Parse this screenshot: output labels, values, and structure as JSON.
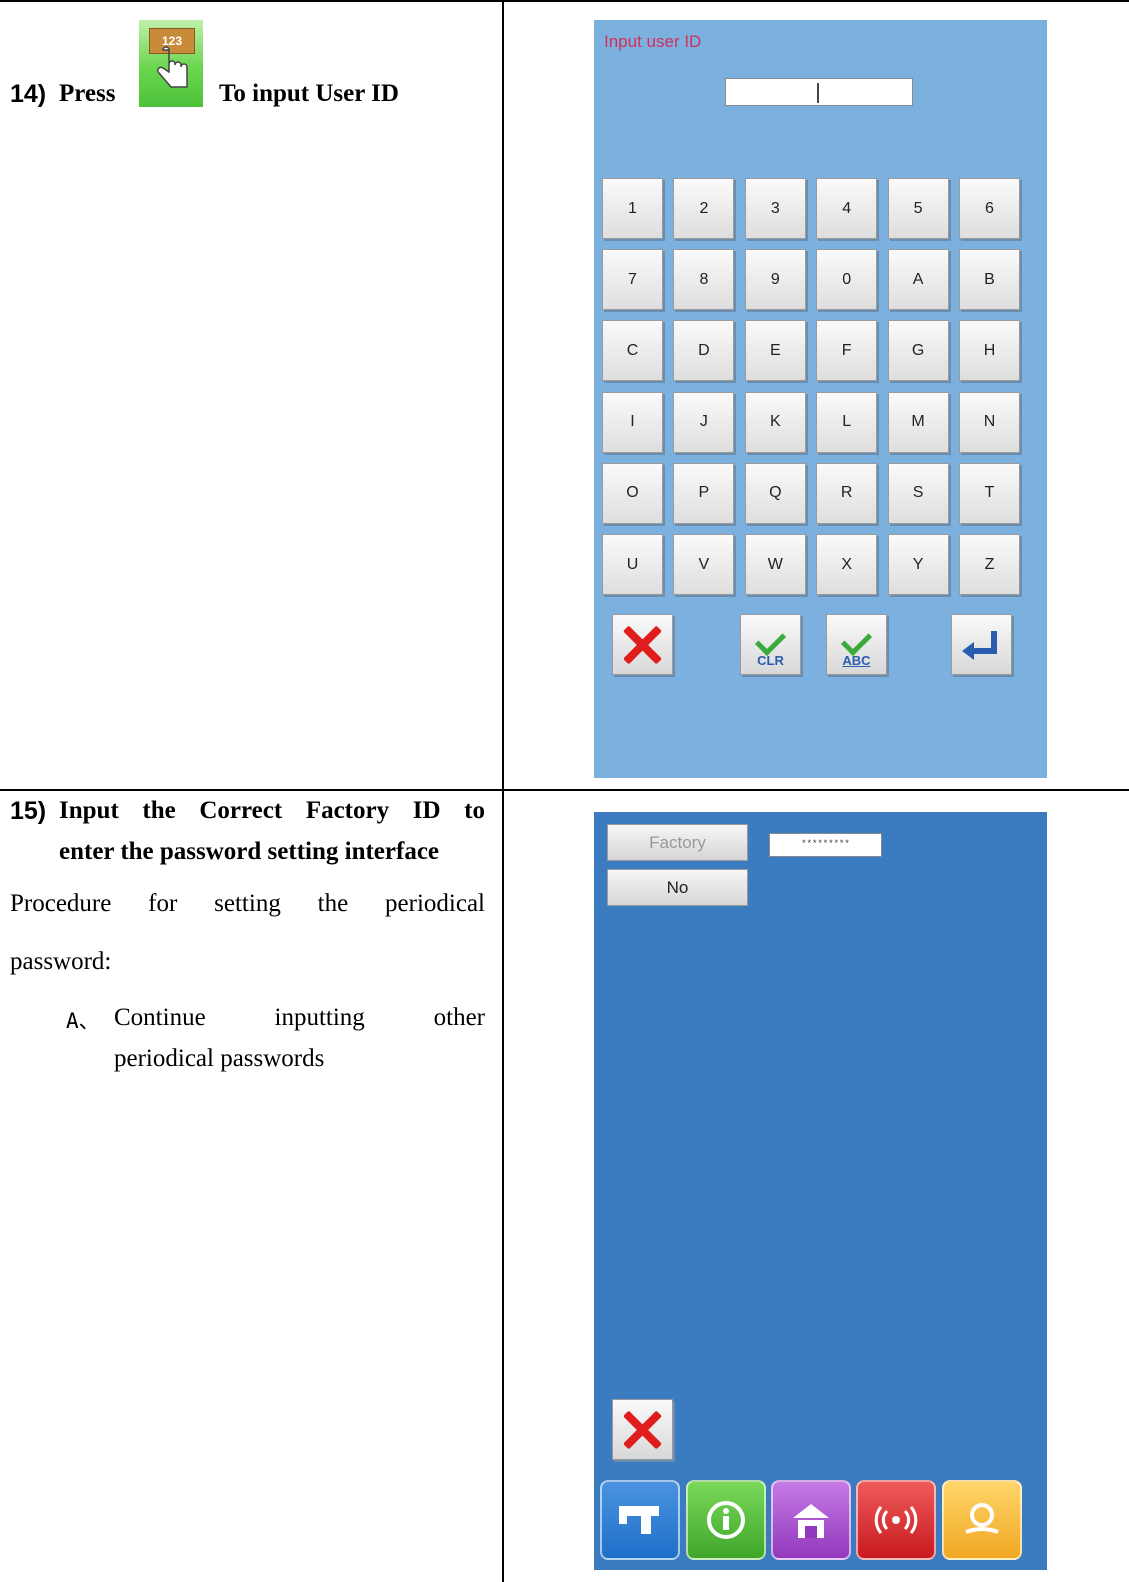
{
  "step14": {
    "number": "14)",
    "press": "Press",
    "rest": "To input User ID",
    "icon": "green-press-icon",
    "icon_digits": "123"
  },
  "screen1": {
    "title": "Input user ID",
    "keys": [
      "1",
      "2",
      "3",
      "4",
      "5",
      "6",
      "7",
      "8",
      "9",
      "0",
      "A",
      "B",
      "C",
      "D",
      "E",
      "F",
      "G",
      "H",
      "I",
      "J",
      "K",
      "L",
      "M",
      "N",
      "O",
      "P",
      "Q",
      "R",
      "S",
      "T",
      "U",
      "V",
      "W",
      "X",
      "Y",
      "Z"
    ],
    "clr_label": "CLR",
    "abc_label": "ABC",
    "bg_color": "#7cb0df",
    "title_color": "#d2305a"
  },
  "step15": {
    "number": "15)",
    "heading_line1": "Input the Correct Factory ID to",
    "heading_line2": "enter the password setting interface",
    "para_line1": "Procedure for setting the periodical",
    "para_line2": "password:",
    "item_marker": "A、",
    "item_line1": "Continue inputting other",
    "item_line2": "periodical passwords"
  },
  "screen2": {
    "factory_label": "Factory",
    "password_mask": "*********",
    "no_label": "No",
    "bg_color": "#3b7cc0",
    "tabs": [
      {
        "icon": "sewing-machine-icon",
        "color": "#1f6fc9"
      },
      {
        "icon": "info-icon",
        "color": "#4cb52a"
      },
      {
        "icon": "home-icon",
        "color": "#a046c8"
      },
      {
        "icon": "wireless-icon",
        "color": "#d9232a"
      },
      {
        "icon": "search-icon",
        "color": "#f2b42a"
      }
    ]
  }
}
